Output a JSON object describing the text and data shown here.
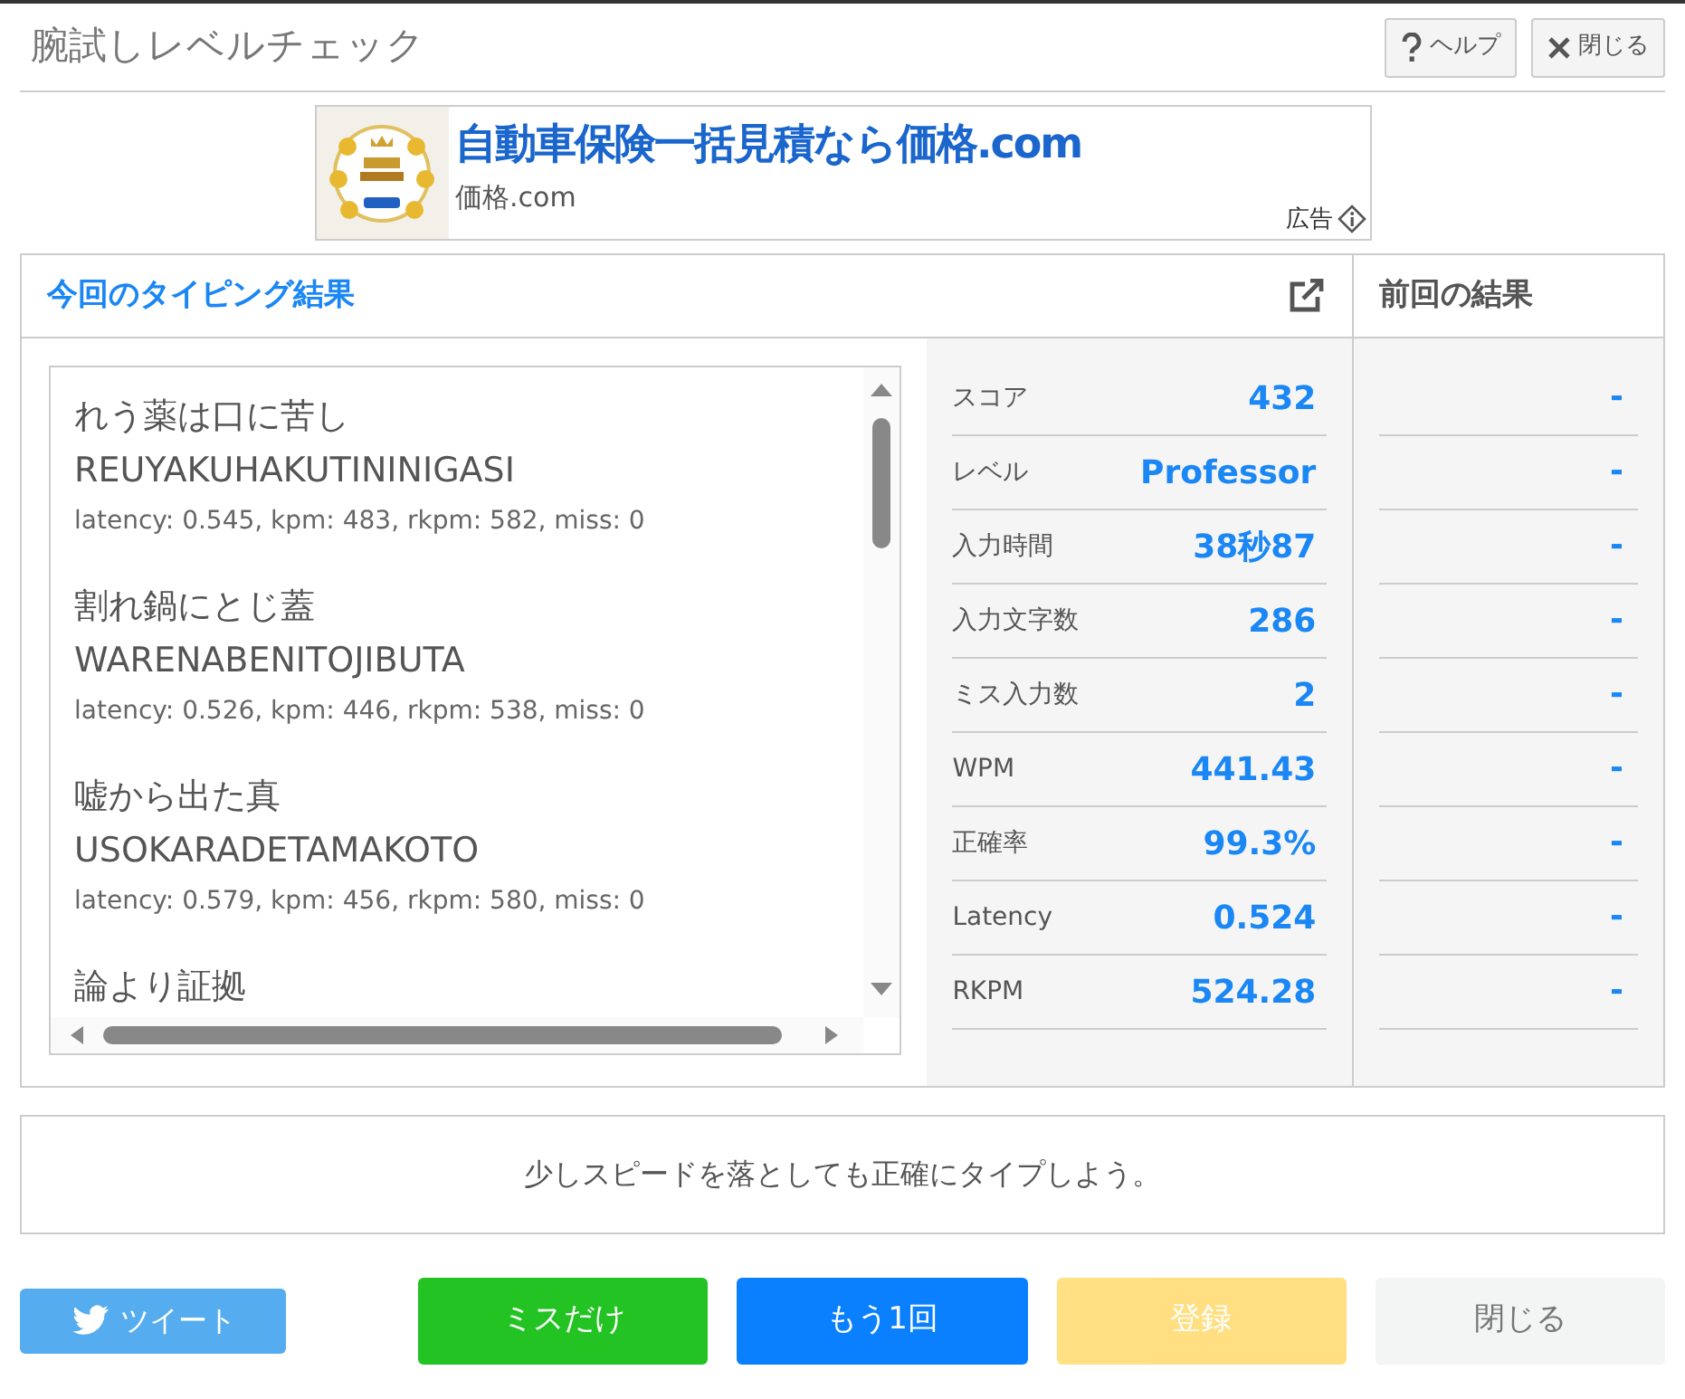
{
  "header": {
    "title": "腕試しレベルチェック",
    "buttons": [
      {
        "kind": "help",
        "label": "ヘルプ"
      },
      {
        "kind": "close",
        "label": "閉じる"
      }
    ]
  },
  "ad": {
    "kind": "picture",
    "headline": "自動車保険一括見積なら価格.com",
    "source": "価格.com",
    "label": "広告"
  },
  "current": {
    "title": "今回のタイピング結果",
    "entries": [
      {
        "phrase": "れう薬は口に苦し",
        "romaji": "REUYAKUHAKUTININIGASI",
        "stats": "latency: 0.545, kpm: 483, rkpm: 582, miss: 0"
      },
      {
        "phrase": "割れ鍋にとじ蓋",
        "romaji": "WARENABENITOJIBUTA",
        "stats": "latency: 0.526, kpm: 446, rkpm: 538, miss: 0"
      },
      {
        "phrase": "嘘から出た真",
        "romaji": "USOKARADETAMAKOTO",
        "stats": "latency: 0.579, kpm: 456, rkpm: 580, miss: 0"
      },
      {
        "phrase": "論より証拠"
      }
    ],
    "metrics": [
      {
        "label": "スコア",
        "value": "432"
      },
      {
        "label": "レベル",
        "value": "Professor"
      },
      {
        "label": "入力時間",
        "value": "38秒87"
      },
      {
        "label": "入力文字数",
        "value": "286"
      },
      {
        "label": "ミス入力数",
        "value": "2"
      },
      {
        "label": "WPM",
        "value": "441.43"
      },
      {
        "label": "正確率",
        "value": "99.3%"
      },
      {
        "label": "Latency",
        "value": "0.524"
      },
      {
        "label": "RKPM",
        "value": "524.28"
      }
    ]
  },
  "previous": {
    "title": "前回の結果",
    "values": [
      "-",
      "-",
      "-",
      "-",
      "-",
      "-",
      "-",
      "-",
      "-"
    ]
  },
  "message": "少しスピードを落としても正確にタイプしよう。",
  "actions": [
    {
      "label": "ツイート",
      "kind": "tweet",
      "disabled": false
    },
    {
      "label": "ミスだけ",
      "kind": "success",
      "disabled": false
    },
    {
      "label": "もう1回",
      "kind": "primary",
      "disabled": false
    },
    {
      "label": "登録",
      "kind": "warning",
      "disabled": true
    },
    {
      "label": "閉じる",
      "kind": "light",
      "disabled": false
    }
  ]
}
